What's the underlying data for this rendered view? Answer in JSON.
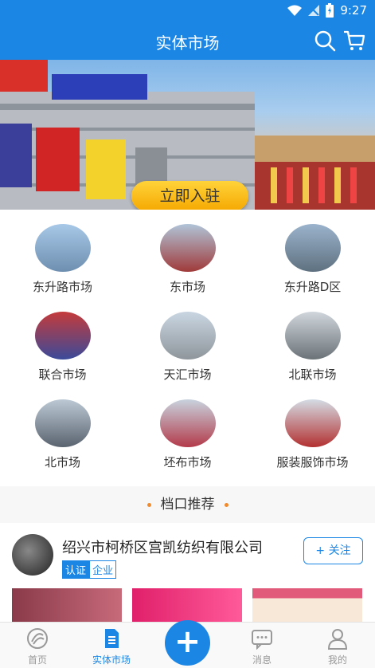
{
  "status_bar": {
    "time": "9:27"
  },
  "header": {
    "title": "实体市场"
  },
  "banner": {
    "cta_label": "立即入驻"
  },
  "markets": [
    {
      "label": "东升路市场"
    },
    {
      "label": "东市场"
    },
    {
      "label": "东升路D区"
    },
    {
      "label": "联合市场"
    },
    {
      "label": "天汇市场"
    },
    {
      "label": "北联市场"
    },
    {
      "label": "北市场"
    },
    {
      "label": "坯布市场"
    },
    {
      "label": "服装服饰市场"
    }
  ],
  "section": {
    "title": "档口推荐"
  },
  "shop": {
    "name": "绍兴市柯桥区宫凯纺织有限公司",
    "cert_label": "认证",
    "cert_type": "企业",
    "follow_label": "+ 关注"
  },
  "tabbar": {
    "items": [
      {
        "label": "首页",
        "icon": "home-icon"
      },
      {
        "label": "实体市场",
        "icon": "market-icon"
      },
      {
        "label": "",
        "icon": "plus-icon"
      },
      {
        "label": "消息",
        "icon": "message-icon"
      },
      {
        "label": "我的",
        "icon": "profile-icon"
      }
    ]
  },
  "colors": {
    "brand": "#1c86e5",
    "accent": "#f5b400",
    "dot": "#f08a2c"
  }
}
